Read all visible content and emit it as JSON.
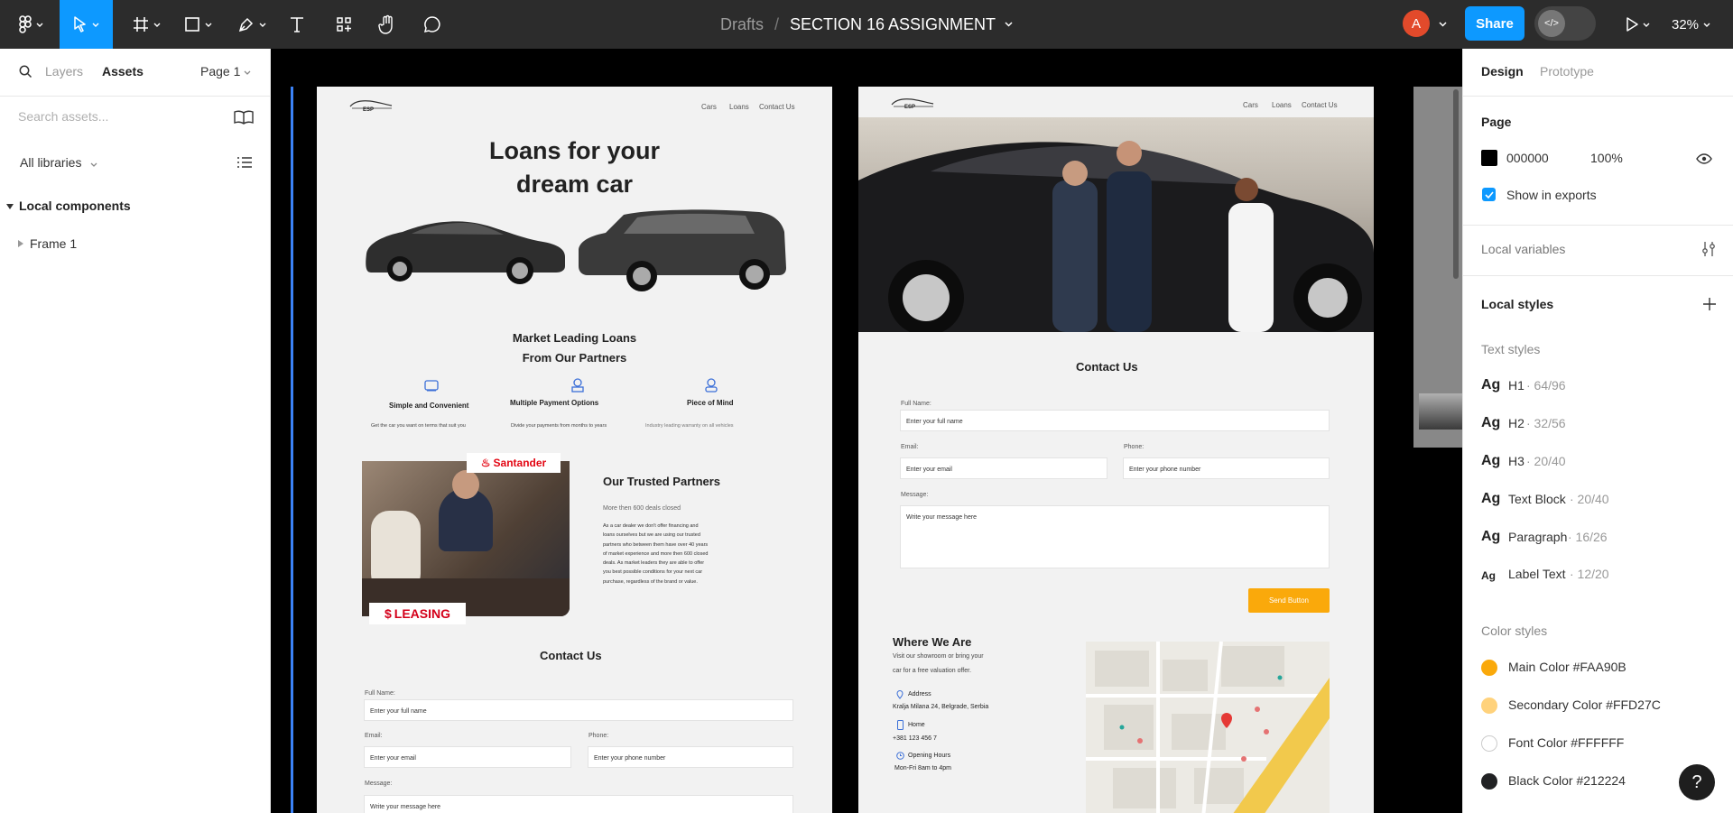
{
  "toolbar": {
    "file_location": "Drafts",
    "file_name": "SECTION 16 ASSIGNMENT",
    "avatar_initial": "A",
    "share_label": "Share",
    "zoom_level": "32%"
  },
  "left_panel": {
    "tabs": [
      "Layers",
      "Assets"
    ],
    "page_selector": "Page 1",
    "search_placeholder": "Search assets...",
    "libraries_filter": "All libraries",
    "section_title": "Local components",
    "items": [
      "Frame 1"
    ]
  },
  "frame1": {
    "nav_logo": "ESP",
    "nav_links": [
      "Cars",
      "Loans",
      "Contact Us"
    ],
    "hero_title_line1": "Loans for your",
    "hero_title_line2": "dream car",
    "subtitle_line1": "Market Leading Loans",
    "subtitle_line2": "From Our Partners",
    "features": [
      {
        "title": "Simple and Convenient",
        "text": "Get the car you want on terms that suit you"
      },
      {
        "title": "Multiple Payment Options",
        "text": "Divide your payments from months to years"
      },
      {
        "title": "Piece of Mind",
        "text": "Industry leading warranty on all vehicles"
      }
    ],
    "partner_badge_top": "Santander",
    "partner_badge_bottom": "LEASING",
    "partners_title": "Our Trusted Partners",
    "partners_sub": "More then 600 deals closed",
    "partners_body": [
      "As a car dealer we don't offer financing and",
      "loans ourselves but we are using our trusted",
      "partners who between them have over 40 years",
      "of market experience and more then 600 closed",
      "deals. As market leaders they are able to offer",
      "you best possible conditions for your next car",
      "purchase, regardless of the brand or value."
    ],
    "contact_title": "Contact Us",
    "label_name": "Full Name:",
    "ph_name": "Enter your full name",
    "label_email": "Email:",
    "ph_email": "Enter your email",
    "label_phone": "Phone:",
    "ph_phone": "Enter your phone number",
    "label_message": "Message:",
    "ph_message": "Write your message here"
  },
  "frame2": {
    "nav_logo": "ESP",
    "nav_links": [
      "Cars",
      "Loans",
      "Contact Us"
    ],
    "contact_title": "Contact Us",
    "label_name": "Full Name:",
    "ph_name": "Enter your full name",
    "label_email": "Email:",
    "ph_email": "Enter your email",
    "label_phone": "Phone:",
    "ph_phone": "Enter your phone number",
    "label_message": "Message:",
    "ph_message": "Write your message here",
    "send_button": "Send Button",
    "where_title": "Where We Are",
    "where_text_line1": "Visit our showroom or bring your",
    "where_text_line2": "car for a free valuation offer.",
    "address_label": "Address",
    "address_value": "Kralja Milana 24, Belgrade, Serbia",
    "phone_label": "Home",
    "phone_value": "+381 123 456 7",
    "hours_label": "Opening Hours",
    "hours_value": "Mon-Fri 8am to 4pm"
  },
  "right_panel": {
    "tabs": [
      "Design",
      "Prototype"
    ],
    "page_heading": "Page",
    "bg_hex": "000000",
    "bg_opacity": "100%",
    "show_in_exports": "Show in exports",
    "local_variables": "Local variables",
    "local_styles": "Local styles",
    "text_styles_heading": "Text styles",
    "text_styles": [
      {
        "name": "H1",
        "spec": " · 64/96"
      },
      {
        "name": "H2",
        "spec": " · 32/56"
      },
      {
        "name": "H3",
        "spec": " · 20/40"
      },
      {
        "name": "Text Block",
        "spec": " · 20/40"
      },
      {
        "name": "Paragraph",
        "spec": " · 16/26"
      },
      {
        "name": "Label Text",
        "spec": " · 12/20"
      }
    ],
    "sample_glyph": "Ag",
    "color_styles_heading": "Color styles",
    "color_styles": [
      {
        "name": "Main Color #FAA90B",
        "color": "#FAA90B"
      },
      {
        "name": "Secondary Color #FFD27C",
        "color": "#FFD27C"
      },
      {
        "name": "Font Color #FFFFFF",
        "color": "#FFFFFF"
      },
      {
        "name": "Black Color #212224",
        "color": "#212224"
      }
    ]
  },
  "help_label": "?"
}
